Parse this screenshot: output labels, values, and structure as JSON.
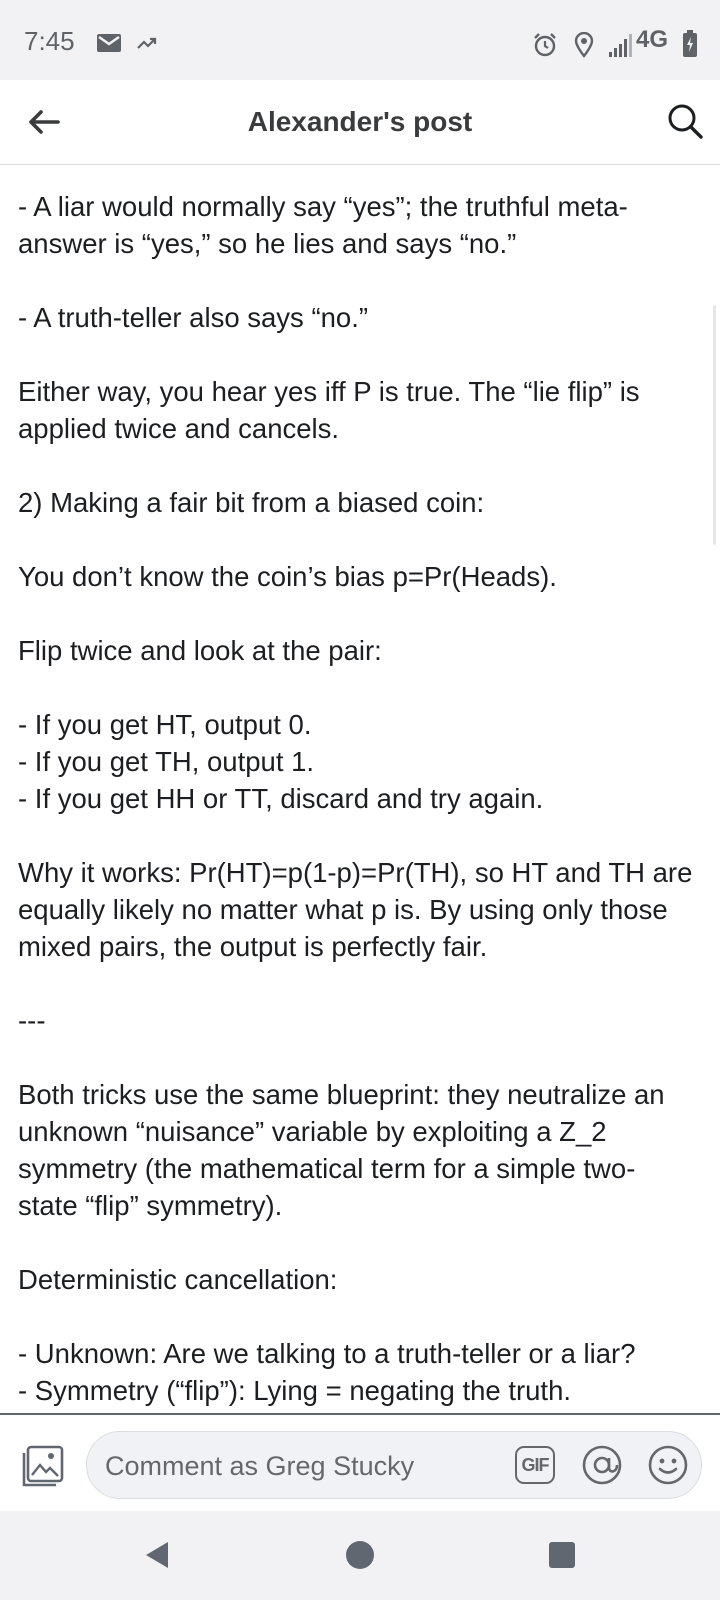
{
  "status_bar": {
    "time": "7:45",
    "network": "4G",
    "icons": [
      "gmail-icon",
      "missed-call-icon",
      "alarm-icon",
      "location-icon",
      "signal-icon",
      "battery-icon"
    ]
  },
  "header": {
    "title": "Alexander's post",
    "back_icon": "arrow-left-icon",
    "search_icon": "search-icon"
  },
  "post": {
    "paragraphs": [
      "- A liar would normally say “yes”; the truthful meta-\nanswer is “yes,” so he lies and says “no.”",
      "- A truth-teller also says “no.”",
      "Either way, you hear yes iff P is true. The “lie flip” is\napplied twice and cancels.",
      "2) Making a fair bit from a biased coin:",
      "You don’t know the coin’s bias p=Pr(Heads).",
      "Flip twice and look at the pair:",
      "- If you get HT, output 0.\n- If you get TH, output 1.\n- If you get HH or TT, discard and try again.",
      "Why it works: Pr(HT)=p(1-p)=Pr(TH), so HT and TH are\nequally likely no matter what p is. By using only those\nmixed pairs, the output is perfectly fair.",
      "---",
      "Both tricks use the same blueprint: they neutralize an\nunknown “nuisance” variable by exploiting a Z_2\nsymmetry (the mathematical term for a simple two-\nstate “flip” symmetry).",
      "Deterministic cancellation:",
      "- Unknown: Are we talking to a truth-teller or a liar?\n- Symmetry (“flip”): Lying = negating the truth."
    ]
  },
  "comment": {
    "placeholder": "Comment as Greg Stucky",
    "gif_label": "GIF"
  },
  "colors": {
    "header_bg": "#ffffff",
    "status_bg": "#f2f2f4",
    "text": "#1c1e21",
    "muted": "#65676b"
  }
}
